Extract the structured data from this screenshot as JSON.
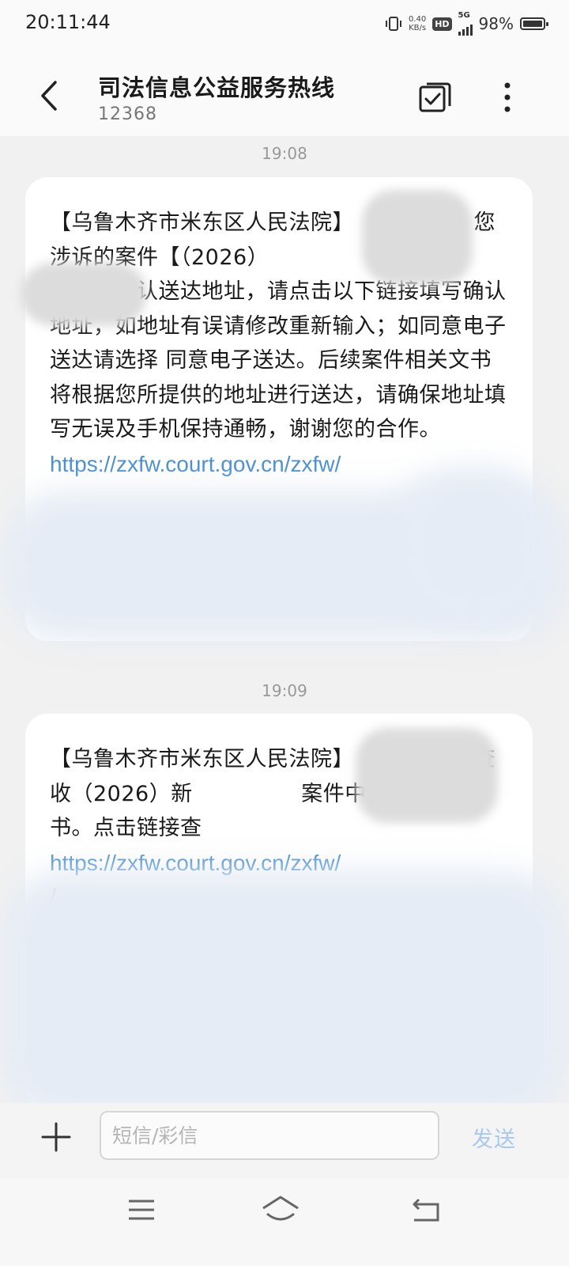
{
  "status_bar": {
    "time": "20:11:44",
    "net_speed_value": "0.40",
    "net_speed_unit": "KB/s",
    "hd": "HD",
    "network": "5G",
    "battery_text": "98%",
    "battery_level": 0.98
  },
  "header": {
    "title": "司法信息公益服务热线",
    "subtitle": "12368"
  },
  "messages": [
    {
      "timestamp": "19:08",
      "text": "【乌鲁木齐市米东区人民法院】　　　您好，您涉诉的案件【（2026）　　　　　　　　　　　】暂未确认送达地址，请点击以下链接填写确认地址，如地址有误请修改重新输入；如同意电子送达请选择 同意电子送达。后续案件相关文书将根据您所提供的地址进行送达，请确保地址填写无误及手机保持通畅，谢谢您的合作。",
      "link": "https://zxfw.court.gov.cn/zxfw/"
    },
    {
      "timestamp": "19:09",
      "text": "【乌鲁木齐市米东区人民法院】　　　好，请查收（2026）新　　　　　案件中你的送达文书。点击链接查",
      "link": "https://zxfw.court.gov.cn/zxfw/",
      "link_tail": "/"
    }
  ],
  "input_bar": {
    "placeholder": "短信/彩信",
    "send_label": "发送"
  },
  "colors": {
    "link": "#4a8fd3",
    "send_disabled": "#a9c9ec",
    "background": "#f1f1f1"
  },
  "icons": [
    "vibrate-icon",
    "back-arrow-icon",
    "multi-select-icon",
    "more-vert-icon",
    "plus-icon",
    "menu-icon",
    "home-icon",
    "back-nav-icon"
  ]
}
